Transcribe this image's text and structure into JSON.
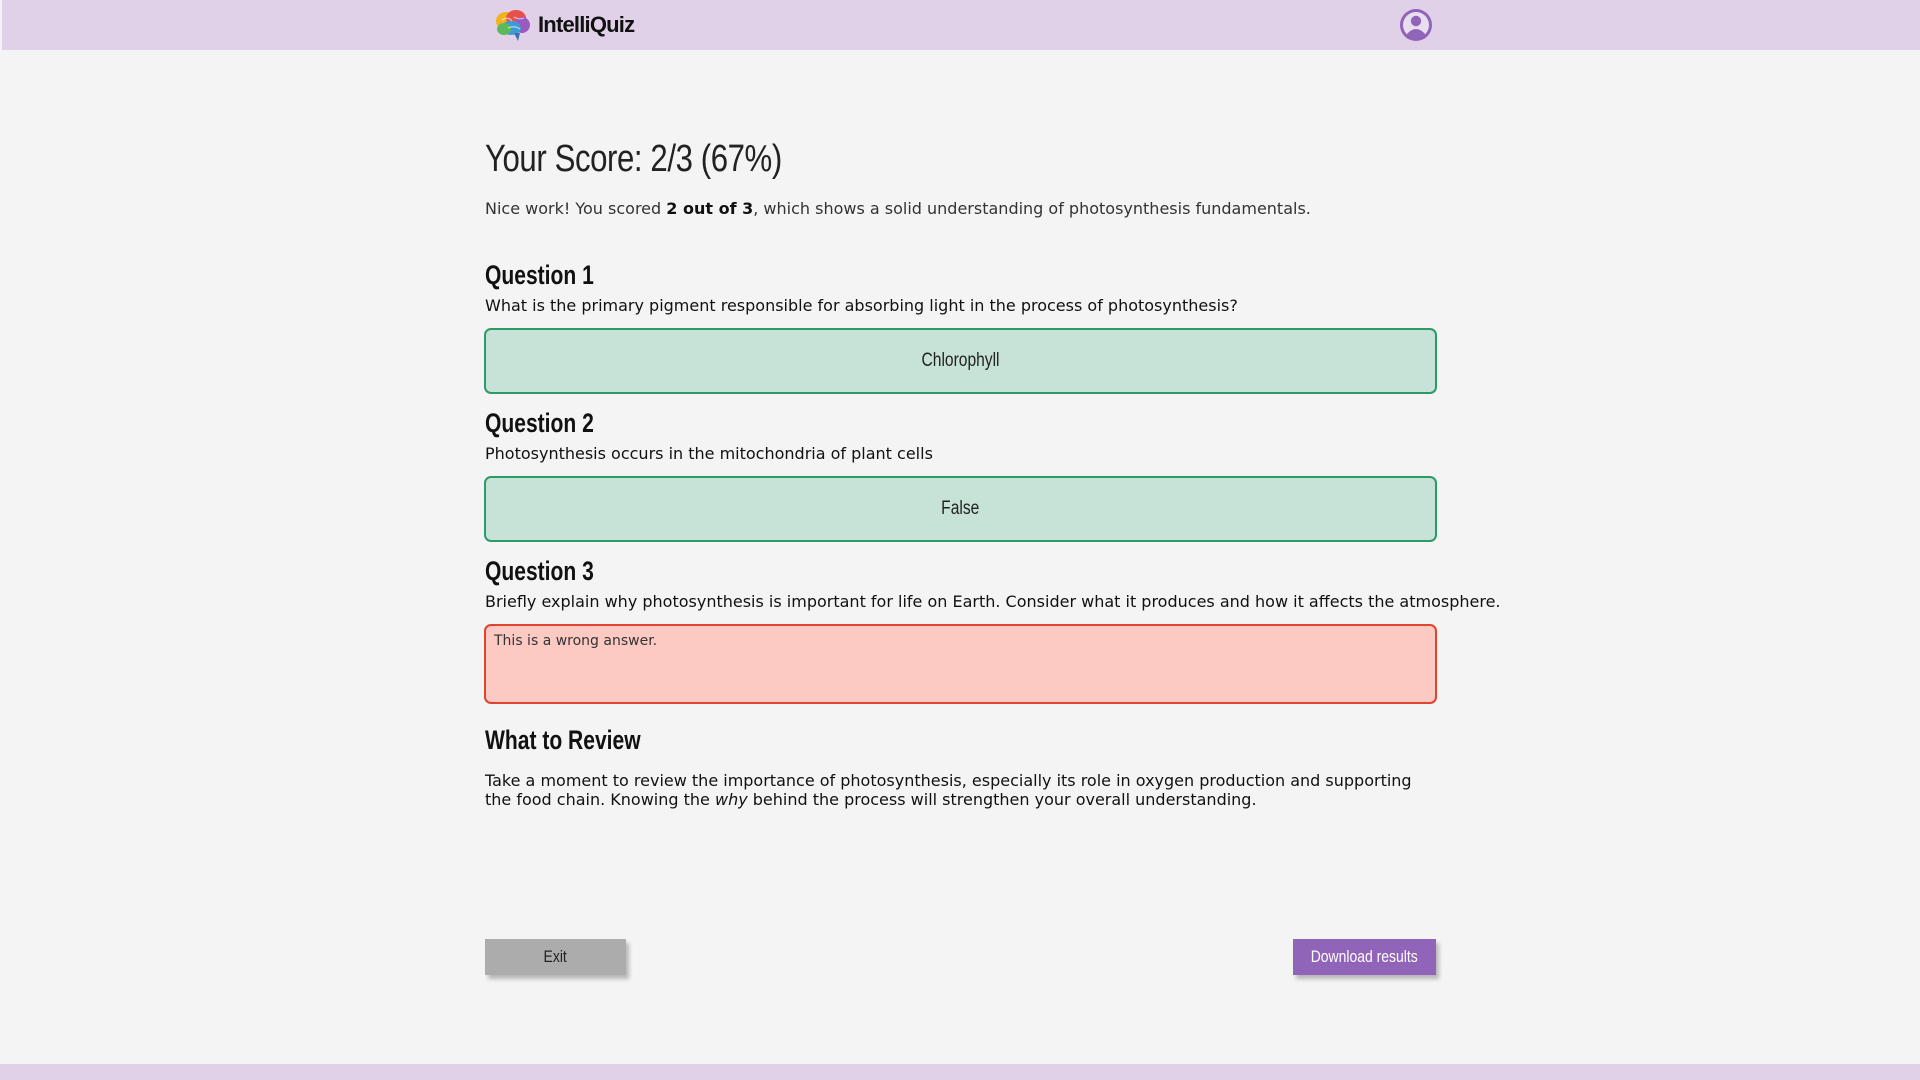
{
  "header": {
    "brand_name": "IntelliQuiz",
    "logo_icon": "brain-icon",
    "profile_icon": "user-avatar-icon"
  },
  "score": {
    "title": "Your Score: 2/3 (67%)",
    "summary_prefix": "Nice work! You scored ",
    "summary_bold": "2 out of 3",
    "summary_suffix": ", which shows a solid understanding of photosynthesis fundamentals."
  },
  "questions": [
    {
      "heading": "Question 1",
      "text": "What is the primary pigment responsible for absorbing light in the process of photosynthesis?",
      "answer": "Chlorophyll",
      "status": "correct"
    },
    {
      "heading": "Question 2",
      "text": "Photosynthesis occurs in the mitochondria of plant cells",
      "answer": "False",
      "status": "correct"
    },
    {
      "heading": "Question 3",
      "text": "Briefly explain why photosynthesis is important for life on Earth. Consider what it produces and how it affects the atmosphere.",
      "answer": "This is a wrong answer.",
      "status": "wrong"
    }
  ],
  "review": {
    "heading": "What to Review",
    "text_part1": "Take a moment to review the importance of photosynthesis, especially its role in oxygen production and supporting the food chain. Knowing the ",
    "text_italic": "why",
    "text_part2": " behind the process will strengthen your overall understanding."
  },
  "actions": {
    "exit_label": "Exit",
    "download_label": "Download results"
  },
  "colors": {
    "header_bg": "#e0d1e9",
    "page_bg": "#f4f4f4",
    "correct_bg": "#c7e3d8",
    "correct_border": "#2e9a68",
    "wrong_bg": "#fcc9c3",
    "wrong_border": "#e0442d",
    "accent": "#9064b8",
    "exit_bg": "#acacac"
  }
}
